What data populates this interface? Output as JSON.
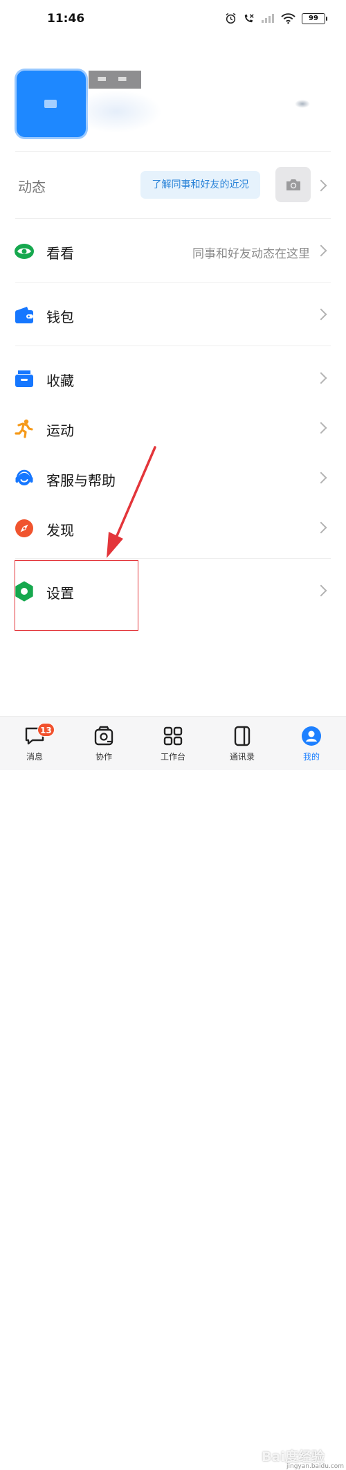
{
  "status_bar": {
    "time": "11:46",
    "battery": "99",
    "icons": [
      "alarm-icon",
      "no-call-icon",
      "cellular-icon",
      "wifi-icon",
      "battery-icon"
    ]
  },
  "moments": {
    "label": "动态",
    "bubble_text": "了解同事和好友的近况",
    "icon": "camera-icon"
  },
  "menu": [
    {
      "id": "look",
      "label": "看看",
      "subtext": "同事和好友动态在这里",
      "icon": "eye-icon",
      "color": "#16a84e"
    },
    {
      "id": "wallet",
      "label": "钱包",
      "subtext": "",
      "icon": "wallet-icon",
      "color": "#1677ff"
    },
    {
      "id": "favorites",
      "label": "收藏",
      "subtext": "",
      "icon": "folder-icon",
      "color": "#1677ff"
    },
    {
      "id": "sports",
      "label": "运动",
      "subtext": "",
      "icon": "running-icon",
      "color": "#f59a1b"
    },
    {
      "id": "support",
      "label": "客服与帮助",
      "subtext": "",
      "icon": "headset-icon",
      "color": "#1677ff"
    },
    {
      "id": "discover",
      "label": "发现",
      "subtext": "",
      "icon": "compass-icon",
      "color": "#f0542e"
    },
    {
      "id": "settings",
      "label": "设置",
      "subtext": "",
      "icon": "gear-icon",
      "color": "#16a84e"
    }
  ],
  "bottom_nav": [
    {
      "id": "messages",
      "label": "消息",
      "icon": "chat-icon",
      "badge": "13",
      "active": false
    },
    {
      "id": "collab",
      "label": "协作",
      "icon": "collab-icon",
      "badge": "",
      "active": false
    },
    {
      "id": "workbench",
      "label": "工作台",
      "icon": "grid-icon",
      "badge": "",
      "active": false
    },
    {
      "id": "contacts",
      "label": "通讯录",
      "icon": "contacts-icon",
      "badge": "",
      "active": false
    },
    {
      "id": "me",
      "label": "我的",
      "icon": "profile-icon",
      "badge": "",
      "active": true
    }
  ],
  "watermark": {
    "text": "Bai度经验",
    "sub": "jingyan.baidu.com"
  },
  "colors": {
    "accent": "#1e80ff",
    "annotation": "#e3353a",
    "badge": "#f1512d"
  }
}
